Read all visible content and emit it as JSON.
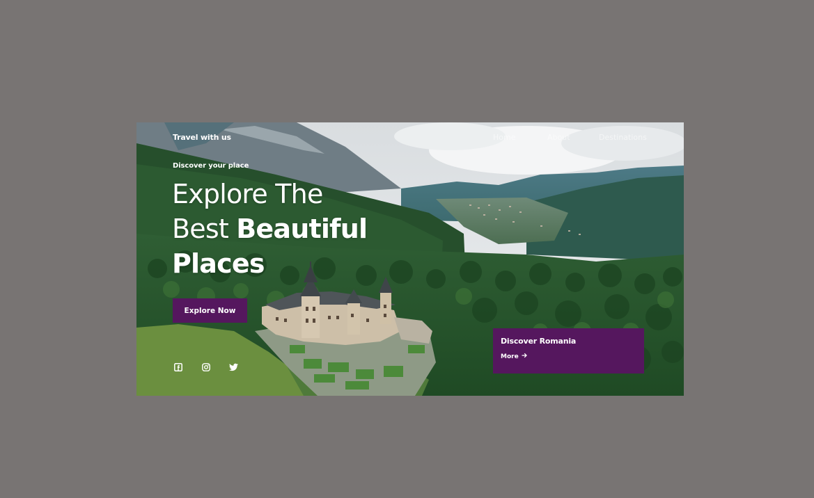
{
  "nav": {
    "brand": "Travel with us",
    "links": [
      "Home",
      "About",
      "Destinations"
    ]
  },
  "hero": {
    "eyebrow": "Discover your place",
    "headline_line1": "Explore The",
    "headline_line2_light": "Best ",
    "headline_line2_bold": "Beautiful",
    "headline_line3": "Places",
    "cta_label": "Explore Now"
  },
  "socials": [
    "facebook-icon",
    "instagram-icon",
    "twitter-icon"
  ],
  "card": {
    "title": "Discover Romania",
    "more_label": "More",
    "more_icon": "arrow-right-icon"
  },
  "colors": {
    "page_background": "#787473",
    "accent": "#55175e",
    "text": "#ffffff"
  }
}
